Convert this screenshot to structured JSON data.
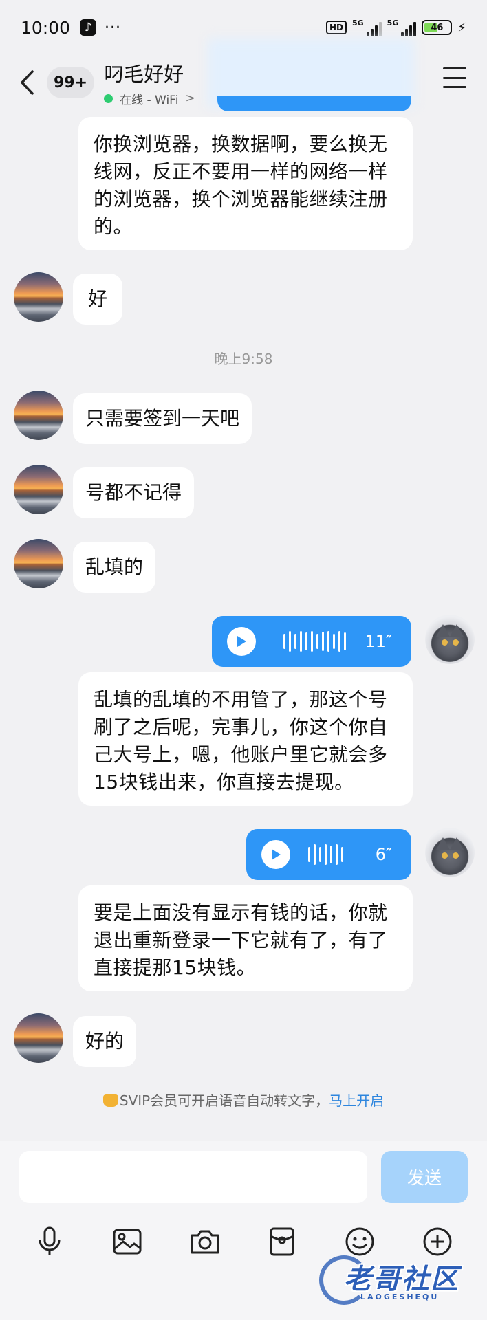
{
  "status_bar": {
    "time": "10:00",
    "dots": "···",
    "network_hd": "HD",
    "net1_label": "5G",
    "net2_label": "5G",
    "battery": "46"
  },
  "header": {
    "unread_count": "99+",
    "title": "叼毛好好",
    "online_status": "在线 - WiFi",
    "online_chevron": ">"
  },
  "chat": {
    "timestamp": "晚上9:58",
    "messages": [
      {
        "side": "self",
        "type": "transcript",
        "text": "你换浏览器，换数据啊，要么换无线网，反正不要用一样的网络一样的浏览器，换个浏览器能继续注册的。"
      },
      {
        "side": "other",
        "type": "text",
        "text": "好"
      },
      {
        "side": "other",
        "type": "text",
        "text": "只需要签到一天吧"
      },
      {
        "side": "other",
        "type": "text",
        "text": "号都不记得"
      },
      {
        "side": "other",
        "type": "text",
        "text": "乱填的"
      },
      {
        "side": "self",
        "type": "voice",
        "duration": "11″"
      },
      {
        "side": "self",
        "type": "transcript",
        "text": "乱填的乱填的不用管了，那这个号刷了之后呢，完事儿，你这个你自己大号上，嗯，他账户里它就会多15块钱出来，你直接去提现。"
      },
      {
        "side": "self",
        "type": "voice",
        "duration": "6″"
      },
      {
        "side": "self",
        "type": "transcript",
        "text": "要是上面没有显示有钱的话，你就退出重新登录一下它就有了，有了直接提那15块钱。"
      },
      {
        "side": "other",
        "type": "text",
        "text": "好的"
      }
    ],
    "svip_notice": "SVIP会员可开启语音自动转文字，",
    "svip_link": "马上开启"
  },
  "composer": {
    "input_value": "",
    "send_label": "发送",
    "tools": [
      "microphone-icon",
      "image-icon",
      "camera-icon",
      "red-packet-icon",
      "emoji-icon",
      "plus-icon"
    ]
  },
  "watermark": {
    "text": "老哥社区",
    "sub": "LAOGESHEQU"
  },
  "colors": {
    "accent": "#2e96f7",
    "send_disabled": "#a6d3fb",
    "online": "#2ecc71",
    "link": "#2e86de"
  }
}
